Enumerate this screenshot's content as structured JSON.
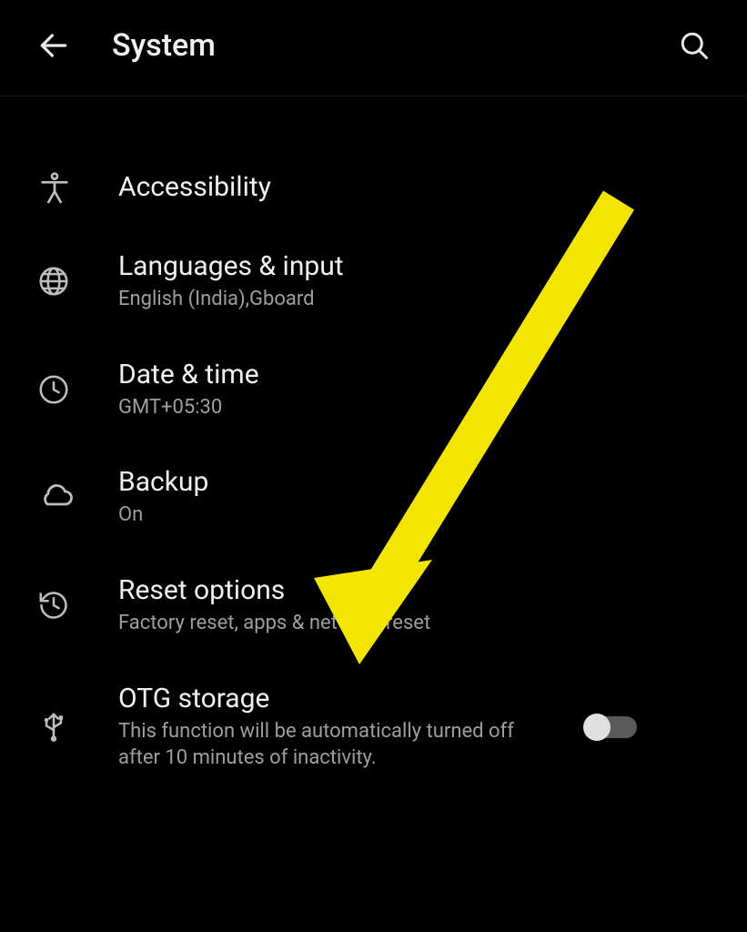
{
  "header": {
    "title": "System"
  },
  "items": [
    {
      "title": "Accessibility",
      "subtitle": null
    },
    {
      "title": "Languages & input",
      "subtitle": "English (India),Gboard"
    },
    {
      "title": "Date & time",
      "subtitle": "GMT+05:30"
    },
    {
      "title": "Backup",
      "subtitle": "On"
    },
    {
      "title": "Reset options",
      "subtitle": "Factory reset, apps & network reset"
    },
    {
      "title": "OTG storage",
      "subtitle": "This function will be automatically turned off after 10 minutes of inactivity."
    }
  ],
  "annotation": {
    "arrow_color": "#F3E500"
  }
}
